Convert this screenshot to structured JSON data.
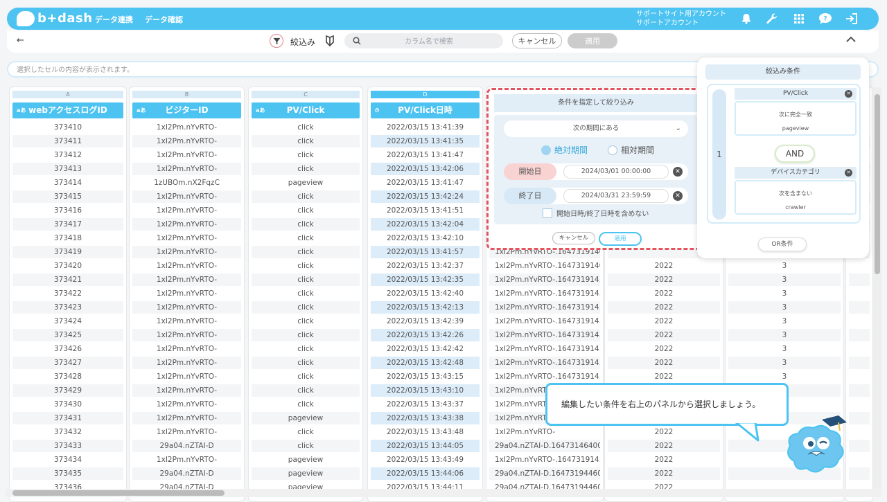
{
  "header": {
    "logo_text": "b+dash",
    "nav": [
      "データ連携",
      "データ確認"
    ],
    "account_line1": "サポートサイト用アカウント",
    "account_line2": "サポートアカウント",
    "icons": [
      "bell-icon",
      "wrench-icon",
      "grid-icon",
      "help-bubble-icon",
      "logout-icon"
    ]
  },
  "toolbar": {
    "back": "←",
    "filter_label": "絞込み",
    "search_placeholder": "カラム名で検索",
    "cancel_label": "キャンセル",
    "apply_label": "適用",
    "collapse": "^"
  },
  "cellbar": {
    "placeholder": "選択したセルの内容が表示されます。"
  },
  "columns": [
    {
      "letter": "A",
      "header": "webアクセスログID",
      "type_icon": "aあ"
    },
    {
      "letter": "B",
      "header": "ビジターID",
      "type_icon": "aあ"
    },
    {
      "letter": "C",
      "header": "PV/Click",
      "type_icon": "aあ"
    },
    {
      "letter": "D",
      "header": "PV/Click日時",
      "type_icon": "⏱"
    }
  ],
  "rows": [
    [
      "373410",
      "1xI2Pm.nYvRTO-",
      "click",
      "2022/03/15 13:41:39",
      "",
      "",
      ""
    ],
    [
      "373411",
      "1xI2Pm.nYvRTO-",
      "click",
      "2022/03/15 13:41:35",
      "",
      "",
      ""
    ],
    [
      "373412",
      "1xI2Pm.nYvRTO-",
      "click",
      "2022/03/15 13:41:47",
      "",
      "",
      ""
    ],
    [
      "373413",
      "1xI2Pm.nYvRTO-",
      "click",
      "2022/03/15 13:42:06",
      "",
      "",
      ""
    ],
    [
      "373414",
      "1zUBOm.nX2FqzC",
      "pageview",
      "2022/03/15 13:41:47",
      "",
      "",
      ""
    ],
    [
      "373415",
      "1xI2Pm.nYvRTO-",
      "click",
      "2022/03/15 13:42:24",
      "",
      "",
      ""
    ],
    [
      "373416",
      "1xI2Pm.nYvRTO-",
      "click",
      "2022/03/15 13:41:51",
      "",
      "",
      ""
    ],
    [
      "373417",
      "1xI2Pm.nYvRTO-",
      "click",
      "2022/03/15 13:42:04",
      "",
      "",
      ""
    ],
    [
      "373418",
      "1xI2Pm.nYvRTO-",
      "click",
      "2022/03/15 13:42:10",
      "",
      "",
      ""
    ],
    [
      "373419",
      "1xI2Pm.nYvRTO-",
      "click",
      "2022/03/15 13:41:57",
      "1xI2Pm.nYvRTO-.1647319140...",
      "",
      ""
    ],
    [
      "373420",
      "1xI2Pm.nYvRTO-",
      "click",
      "2022/03/15 13:42:37",
      "1xI2Pm.nYvRTO-.1647319140...",
      "2022",
      "3"
    ],
    [
      "373421",
      "1xI2Pm.nYvRTO-",
      "click",
      "2022/03/15 13:42:35",
      "1xI2Pm.nYvRTO-.164731914...",
      "2022",
      "3"
    ],
    [
      "373422",
      "1xI2Pm.nYvRTO-",
      "click",
      "2022/03/15 13:42:40",
      "1xI2Pm.nYvRTO-.164731914...",
      "2022",
      "3"
    ],
    [
      "373423",
      "1xI2Pm.nYvRTO-",
      "click",
      "2022/03/15 13:42:13",
      "1xI2Pm.nYvRTO-.164731914...",
      "2022",
      "3"
    ],
    [
      "373424",
      "1xI2Pm.nYvRTO-",
      "click",
      "2022/03/15 13:42:39",
      "1xI2Pm.nYvRTO-.164731914...",
      "2022",
      "3"
    ],
    [
      "373425",
      "1xI2Pm.nYvRTO-",
      "click",
      "2022/03/15 13:42:26",
      "1xI2Pm.nYvRTO-.164731914...",
      "2022",
      "3"
    ],
    [
      "373426",
      "1xI2Pm.nYvRTO-",
      "click",
      "2022/03/15 13:42:42",
      "1xI2Pm.nYvRTO-.164731914...",
      "2022",
      "3"
    ],
    [
      "373427",
      "1xI2Pm.nYvRTO-",
      "click",
      "2022/03/15 13:42:48",
      "1xI2Pm.nYvRTO-.164731914...",
      "2022",
      "3"
    ],
    [
      "373428",
      "1xI2Pm.nYvRTO-",
      "click",
      "2022/03/15 13:43:15",
      "1xI2Pm.nYvRTO-.164731914...",
      "2022",
      "3"
    ],
    [
      "373429",
      "1xI2Pm.nYvRTO-",
      "click",
      "2022/03/15 13:43:10",
      "1xI2Pm.nYvRTO-",
      "",
      ""
    ],
    [
      "373430",
      "1xI2Pm.nYvRTO-",
      "click",
      "2022/03/15 13:43:37",
      "1xI2Pm.nYvRTO-",
      "",
      ""
    ],
    [
      "373431",
      "1xI2Pm.nYvRTO-",
      "pageview",
      "2022/03/15 13:43:38",
      "1xI2Pm.nYvRTO-",
      "",
      ""
    ],
    [
      "373432",
      "1xI2Pm.nYvRTO-",
      "click",
      "2022/03/15 13:43:48",
      "1xI2Pm.nYvRTO-",
      "2022",
      ""
    ],
    [
      "373433",
      "29a04.nZTAI-D",
      "click",
      "2022/03/15 13:44:05",
      "29a04.nZTAI-D.16473146400...",
      "2022",
      ""
    ],
    [
      "373434",
      "1xI2Pm.nYvRTO-",
      "pageview",
      "2022/03/15 13:43:49",
      "1xI2Pm.nYvRTO-.164731914...",
      "2022",
      ""
    ],
    [
      "373435",
      "29a04.nZTAI-D",
      "pageview",
      "2022/03/15 13:44:06",
      "29a04.nZTAI-D.16473194460...",
      "2022",
      ""
    ],
    [
      "373436",
      "29a04.nZTAI-D",
      "pageview",
      "2022/03/15 13:44:11",
      "29a04.nZTAI-D.16473194460...",
      "2022",
      ""
    ]
  ],
  "filter_popup": {
    "title": "条件を指定して絞り込み",
    "operator": "次の期間にある",
    "radio_absolute": "絶対期間",
    "radio_relative": "相対期間",
    "absolute_selected": true,
    "start_label": "開始日",
    "start_value": "2024/03/01 00:00:00",
    "end_label": "終了日",
    "end_value": "2024/03/31 23:59:59",
    "exclude_label": "開始日時/終了日時を含めない",
    "exclude_checked": false,
    "cancel_label": "キャンセル",
    "apply_label": "適用"
  },
  "condition_panel": {
    "title": "絞込み条件",
    "group_number": "1",
    "conditions": [
      {
        "field": "PV/Click",
        "operator": "次に完全一致",
        "value": "pageview"
      },
      {
        "field": "デバイスカテゴリ",
        "operator": "次を含まない",
        "value": "crawler"
      }
    ],
    "and_label": "AND",
    "or_label": "OR条件"
  },
  "tooltip": {
    "text": "編集したい条件を右上のパネルから選択しましょう。"
  },
  "colors": {
    "accent": "#4cc3f1",
    "highlight_border": "#e2555f",
    "header_bg": "#4cc3f1"
  }
}
